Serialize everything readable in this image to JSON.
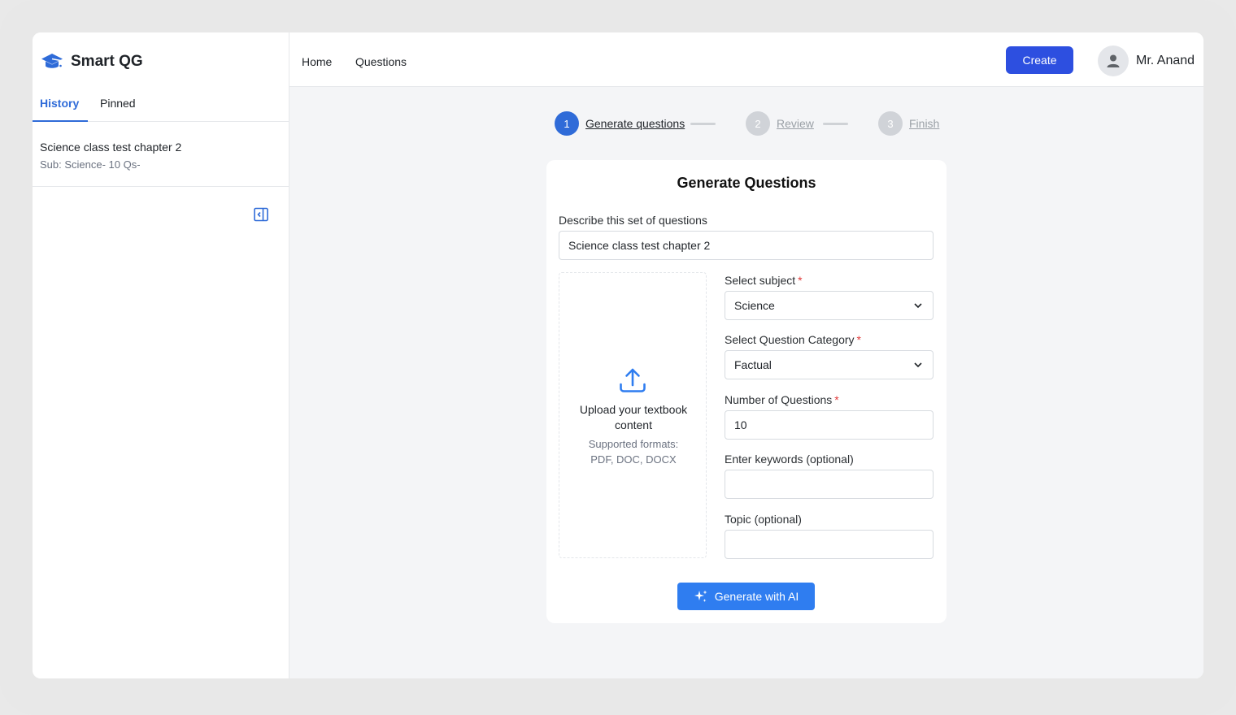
{
  "app": {
    "name": "Smart QG",
    "icon": "graduation-cap-icon",
    "accent_color": "#2f6bd8",
    "primary_button_color": "#2d4fe0"
  },
  "sidebar": {
    "tabs": [
      {
        "label": "History",
        "active": true
      },
      {
        "label": "Pinned",
        "active": false
      }
    ],
    "history": [
      {
        "title": "Science class test chapter 2",
        "subtitle": "Sub: Science- 10 Qs-"
      }
    ],
    "collapse_icon": "collapse-sidebar-icon"
  },
  "header": {
    "nav": [
      {
        "label": "Home"
      },
      {
        "label": "Questions"
      }
    ],
    "create_label": "Create",
    "user_name": "Mr. Anand",
    "avatar_icon": "user-avatar-icon"
  },
  "stepper": {
    "steps": [
      {
        "number": "1",
        "label": "Generate questions",
        "active": true
      },
      {
        "number": "2",
        "label": "Review",
        "active": false
      },
      {
        "number": "3",
        "label": "Finish",
        "active": false
      }
    ]
  },
  "form": {
    "title": "Generate Questions",
    "description": {
      "label": "Describe this set of questions",
      "value": "Science class test chapter 2"
    },
    "upload": {
      "icon": "upload-icon",
      "title": "Upload your textbook content",
      "formats_line1": "Supported formats:",
      "formats_line2": "PDF, DOC, DOCX"
    },
    "subject": {
      "label": "Select subject",
      "required": "*",
      "value": "Science"
    },
    "category": {
      "label": "Select Question Category",
      "required": "*",
      "value": "Factual"
    },
    "num_questions": {
      "label": "Number of Questions",
      "required": "*",
      "value": "10"
    },
    "keywords": {
      "label": "Enter keywords (optional)",
      "value": ""
    },
    "topic": {
      "label": "Topic (optional)",
      "value": ""
    },
    "generate_label": "Generate with AI",
    "generate_icon": "sparkle-icon"
  }
}
